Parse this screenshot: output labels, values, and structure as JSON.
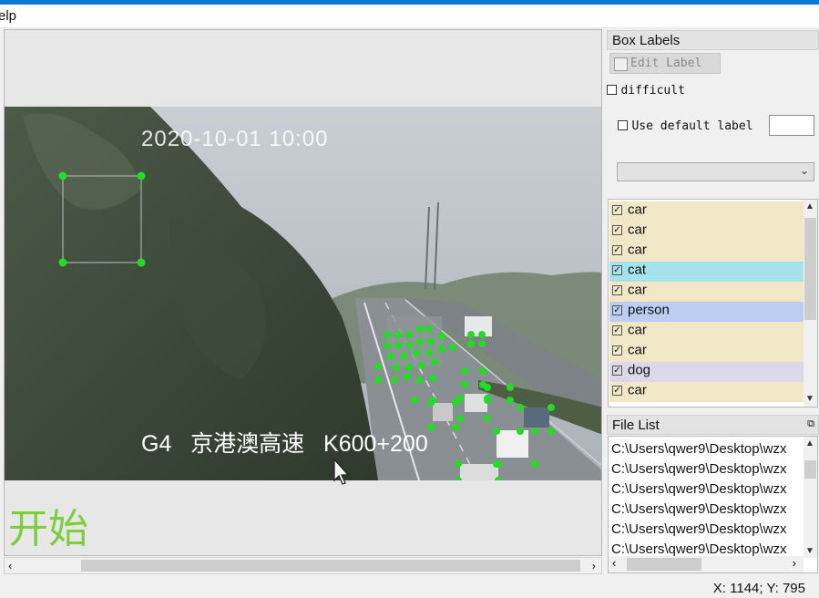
{
  "menu": {
    "help_label": "elp"
  },
  "canvas": {
    "timestamp": "2020-10-01 10:00",
    "road_caption": "G4   京港澳高速   K600+200",
    "start_label": "开始"
  },
  "box_labels": {
    "title": "Box Labels",
    "edit_label": "Edit Label",
    "difficult_label": "difficult",
    "use_default_label": "Use default label",
    "default_label_value": "",
    "label_select_value": ""
  },
  "label_items": [
    {
      "label": "car",
      "bg": "#f1e6c6"
    },
    {
      "label": "car",
      "bg": "#f1e6c6"
    },
    {
      "label": "car",
      "bg": "#f1e6c6"
    },
    {
      "label": "cat",
      "bg": "#a4e3ec"
    },
    {
      "label": "car",
      "bg": "#f1e6c6"
    },
    {
      "label": "person",
      "bg": "#bccdef"
    },
    {
      "label": "car",
      "bg": "#f1e6c6"
    },
    {
      "label": "car",
      "bg": "#f1e6c6"
    },
    {
      "label": "dog",
      "bg": "#dcd8ea"
    },
    {
      "label": "car",
      "bg": "#f1e6c6"
    }
  ],
  "file_list": {
    "title": "File List",
    "items": [
      "C:\\Users\\qwer9\\Desktop\\wzx",
      "C:\\Users\\qwer9\\Desktop\\wzx",
      "C:\\Users\\qwer9\\Desktop\\wzx",
      "C:\\Users\\qwer9\\Desktop\\wzx",
      "C:\\Users\\qwer9\\Desktop\\wzx",
      "C:\\Users\\qwer9\\Desktop\\wzx"
    ]
  },
  "status": {
    "coords": "X: 1144; Y: 795"
  },
  "colors": {
    "accent": "#0a78d4",
    "annotation_point": "#22dd22",
    "start_text": "#7ccf3b"
  }
}
